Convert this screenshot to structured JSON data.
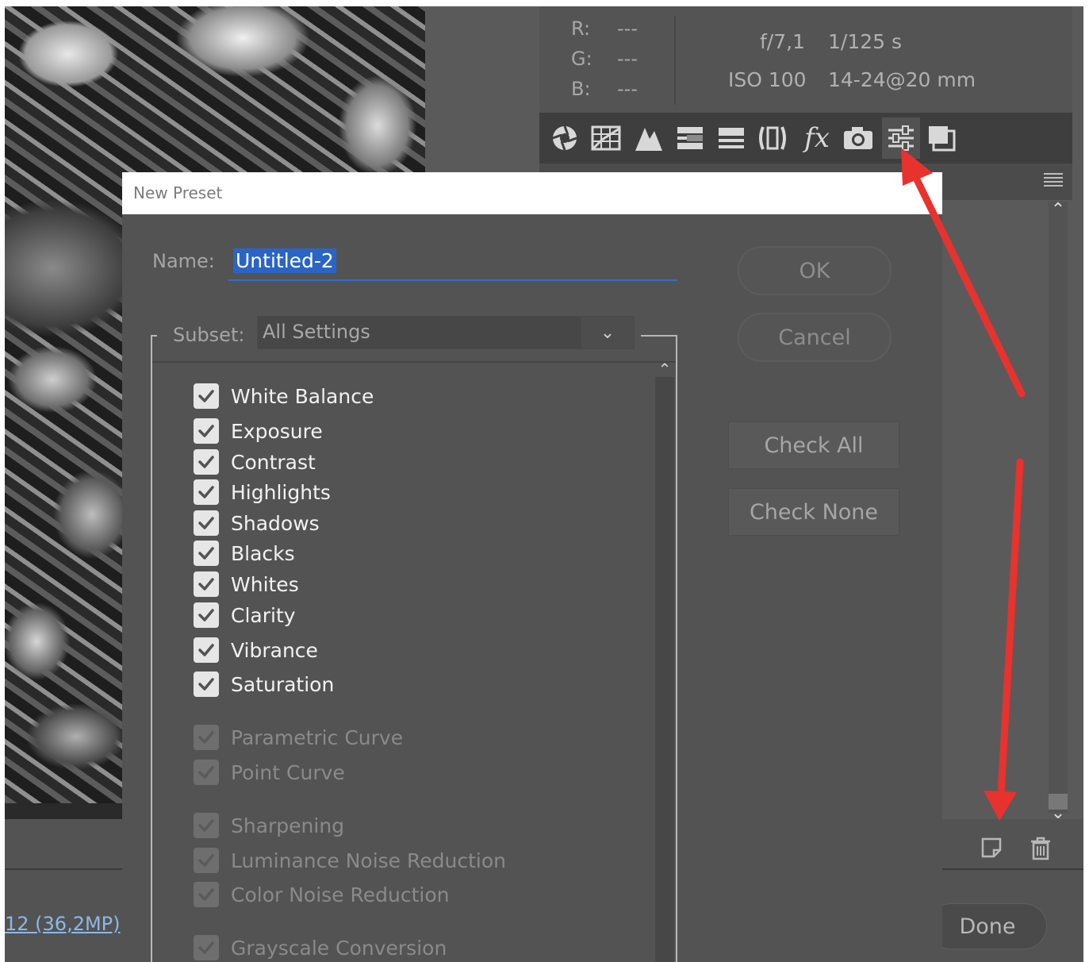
{
  "editor": {
    "info": {
      "r_label": "R:",
      "g_label": "G:",
      "b_label": "B:",
      "r_value": "---",
      "g_value": "---",
      "b_value": "---",
      "aperture": "f/7,1",
      "shutter": "1/125 s",
      "iso": "ISO 100",
      "lens": "14-24@20 mm"
    },
    "toolbar_icons": [
      "basic-icon",
      "tone-curve-icon",
      "detail-icon",
      "hsl-icon",
      "split-toning-icon",
      "lens-corrections-icon",
      "effects-icon",
      "camera-calibration-icon",
      "presets-icon",
      "snapshots-icon"
    ],
    "image_size_text": "12 (36,2MP)",
    "done_label": "Done"
  },
  "dialog": {
    "title": "New Preset",
    "name_label": "Name:",
    "name_value": "Untitled-2",
    "subset_label": "Subset:",
    "subset_value": "All Settings",
    "ok_label": "OK",
    "cancel_label": "Cancel",
    "check_all_label": "Check All",
    "check_none_label": "Check None",
    "settings": [
      {
        "label": "White Balance",
        "checked": true,
        "enabled": true
      },
      {
        "label": "Exposure",
        "checked": true,
        "enabled": true
      },
      {
        "label": "Contrast",
        "checked": true,
        "enabled": true
      },
      {
        "label": "Highlights",
        "checked": true,
        "enabled": true
      },
      {
        "label": "Shadows",
        "checked": true,
        "enabled": true
      },
      {
        "label": "Blacks",
        "checked": true,
        "enabled": true
      },
      {
        "label": "Whites",
        "checked": true,
        "enabled": true
      },
      {
        "label": "Clarity",
        "checked": true,
        "enabled": true
      },
      {
        "label": "Vibrance",
        "checked": true,
        "enabled": true
      },
      {
        "label": "Saturation",
        "checked": true,
        "enabled": true
      },
      {
        "label": "Parametric Curve",
        "checked": true,
        "enabled": false
      },
      {
        "label": "Point Curve",
        "checked": true,
        "enabled": false
      },
      {
        "label": "Sharpening",
        "checked": true,
        "enabled": false
      },
      {
        "label": "Luminance Noise Reduction",
        "checked": true,
        "enabled": false
      },
      {
        "label": "Color Noise Reduction",
        "checked": true,
        "enabled": false
      },
      {
        "label": "Grayscale Conversion",
        "checked": true,
        "enabled": false
      }
    ]
  },
  "colors": {
    "arrow": "#e8322e",
    "selection": "#2a64c6"
  }
}
